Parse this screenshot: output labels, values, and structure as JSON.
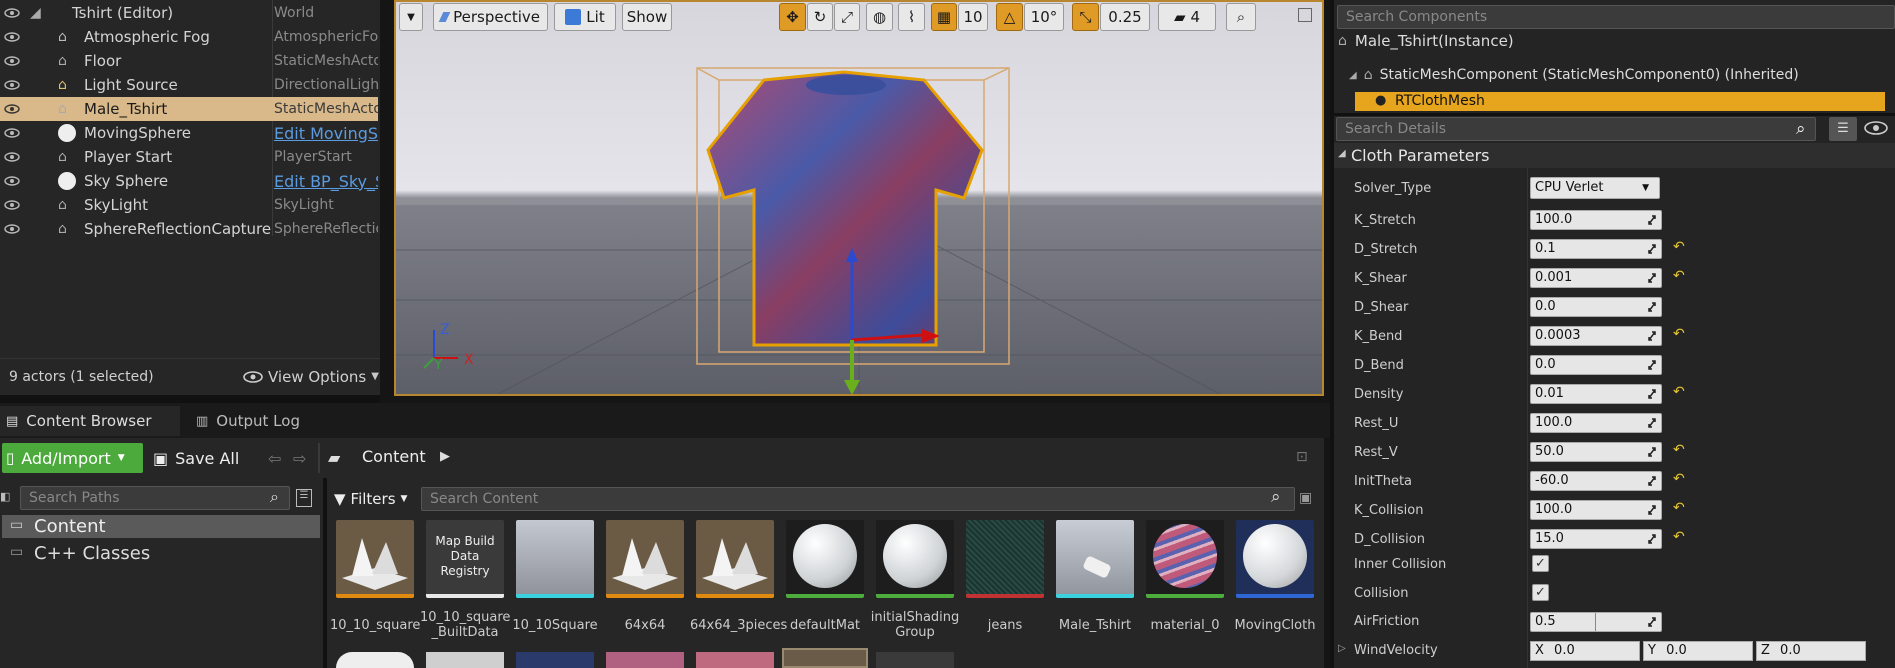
{
  "outliner": {
    "rows": [
      {
        "name": "Tshirt (Editor)",
        "type": "World"
      },
      {
        "name": "Atmospheric Fog",
        "type": "AtmosphericFog"
      },
      {
        "name": "Floor",
        "type": "StaticMeshActor"
      },
      {
        "name": "Light Source",
        "type": "DirectionalLight"
      },
      {
        "name": "Male_Tshirt",
        "type": "StaticMeshActor"
      },
      {
        "name": "MovingSphere",
        "type": "Edit MovingSphere"
      },
      {
        "name": "Player Start",
        "type": "PlayerStart"
      },
      {
        "name": "Sky Sphere",
        "type": "Edit BP_Sky_Sphere"
      },
      {
        "name": "SkyLight",
        "type": "SkyLight"
      },
      {
        "name": "SphereReflectionCapture",
        "type": "SphereReflectionCapture"
      }
    ],
    "status": "9 actors (1 selected)",
    "view_options": "View Options"
  },
  "viewport": {
    "perspective": "Perspective",
    "lit": "Lit",
    "show": "Show",
    "grid_snap": "10",
    "rot_snap": "10°",
    "scale_snap": "0.25",
    "cam_speed": "4"
  },
  "components": {
    "search_placeholder": "Search Components",
    "instance": "Male_Tshirt(Instance)",
    "root": "StaticMeshComponent (StaticMeshComponent0) (Inherited)",
    "child": "RTClothMesh"
  },
  "details": {
    "search_placeholder": "Search Details",
    "section": "Cloth Parameters",
    "solver_label": "Solver_Type",
    "solver_value": "CPU Verlet",
    "params": [
      {
        "label": "K_Stretch",
        "value": "100.0",
        "reset": false
      },
      {
        "label": "D_Stretch",
        "value": "0.1",
        "reset": true
      },
      {
        "label": "K_Shear",
        "value": "0.001",
        "reset": true
      },
      {
        "label": "D_Shear",
        "value": "0.0",
        "reset": false
      },
      {
        "label": "K_Bend",
        "value": "0.0003",
        "reset": true
      },
      {
        "label": "D_Bend",
        "value": "0.0",
        "reset": false
      },
      {
        "label": "Density",
        "value": "0.01",
        "reset": true
      },
      {
        "label": "Rest_U",
        "value": "100.0",
        "reset": false
      },
      {
        "label": "Rest_V",
        "value": "50.0",
        "reset": true
      },
      {
        "label": "InitTheta",
        "value": "-60.0",
        "reset": true
      },
      {
        "label": "K_Collision",
        "value": "100.0",
        "reset": true
      },
      {
        "label": "D_Collision",
        "value": "15.0",
        "reset": true
      }
    ],
    "inner_collision": "Inner Collision",
    "collision": "Collision",
    "air_friction_label": "AirFriction",
    "air_friction": "0.5",
    "wind_label": "WindVelocity",
    "wind_x_label": "X",
    "wind_x": "0.0",
    "wind_y_label": "Y",
    "wind_y": "0.0",
    "wind_z_label": "Z",
    "wind_z": "0.0"
  },
  "content_browser": {
    "tab_cb": "Content Browser",
    "tab_log": "Output Log",
    "add_import": "Add/Import",
    "save_all": "Save All",
    "path": "Content",
    "search_paths": "Search Paths",
    "filters": "Filters",
    "search_content": "Search Content",
    "tree": [
      "Content",
      "C++ Classes"
    ],
    "map_build_text": "Map Build Data Registry",
    "assets": [
      {
        "name": "10_10_square",
        "kind": "mesh",
        "bar": "#e08a10"
      },
      {
        "name": "10_10_square _BuiltData",
        "kind": "mapbuild",
        "bar": "#e8e8e8"
      },
      {
        "name": "10_10Square",
        "kind": "floor",
        "bar": "#3ad2de"
      },
      {
        "name": "64x64",
        "kind": "mesh",
        "bar": "#e08a10"
      },
      {
        "name": "64x64_3pieces",
        "kind": "mesh",
        "bar": "#e08a10"
      },
      {
        "name": "defaultMat",
        "kind": "sphere",
        "bar": "#4cad3c"
      },
      {
        "name": "initialShading Group",
        "kind": "sphere",
        "bar": "#4cad3c"
      },
      {
        "name": "jeans",
        "kind": "jeans",
        "bar": "#c23232"
      },
      {
        "name": "Male_Tshirt",
        "kind": "shirtmesh",
        "bar": "#3ad2de"
      },
      {
        "name": "material_0",
        "kind": "swirl",
        "bar": "#4cad3c"
      },
      {
        "name": "MovingCloth",
        "kind": "blue",
        "bar": "#2f66d6"
      }
    ]
  }
}
